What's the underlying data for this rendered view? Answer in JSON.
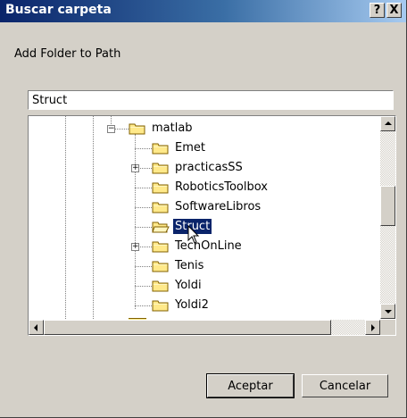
{
  "window": {
    "title": "Buscar carpeta",
    "help_label": "?",
    "close_label": "X"
  },
  "instruction": "Add Folder to Path",
  "folder_input": {
    "value": "Struct"
  },
  "tree": {
    "items": [
      {
        "label": "matlab",
        "expander": "−"
      },
      {
        "label": "Emet"
      },
      {
        "label": "practicasSS",
        "expander": "+"
      },
      {
        "label": "RoboticsToolbox"
      },
      {
        "label": "SoftwareLibros"
      },
      {
        "label": "Struct",
        "selected": true
      },
      {
        "label": "TechOnLine",
        "expander": "+"
      },
      {
        "label": "Tenis"
      },
      {
        "label": "Yoldi"
      },
      {
        "label": "Yoldi2"
      }
    ]
  },
  "buttons": {
    "ok": "Aceptar",
    "cancel": "Cancelar"
  },
  "colors": {
    "selection": "#0a246a",
    "folder": "#ffe98a",
    "dialog": "#d4d0c8"
  }
}
